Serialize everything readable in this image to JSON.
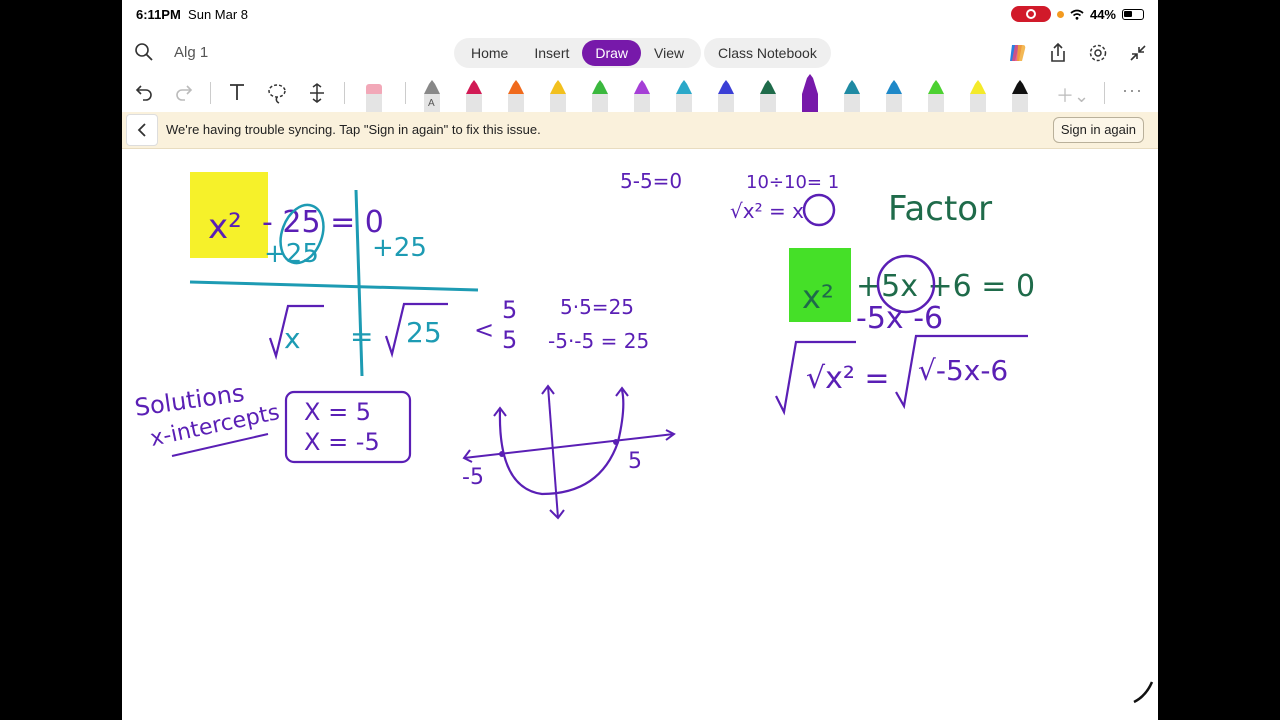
{
  "status": {
    "time": "6:11PM",
    "date": "Sun Mar 8",
    "battery": "44%"
  },
  "header": {
    "notebook_title": "Alg 1"
  },
  "tabs": [
    {
      "label": "Home",
      "active": false
    },
    {
      "label": "Insert",
      "active": false
    },
    {
      "label": "Draw",
      "active": true
    },
    {
      "label": "View",
      "active": false
    }
  ],
  "class_notebook_label": "Class Notebook",
  "icons": {
    "top_right": [
      "copilot-icon",
      "share-icon",
      "settings-icon",
      "collapse-icon"
    ],
    "toolbar": [
      "undo-icon",
      "redo-icon",
      "text-icon",
      "lasso-icon",
      "insert-space-icon",
      "eraser-icon",
      "add-pen-icon",
      "more-icon"
    ]
  },
  "pens": [
    {
      "color": "#888888",
      "label": "A"
    },
    {
      "color": "#d11a54",
      "label": ""
    },
    {
      "color": "#f06a1c",
      "label": ""
    },
    {
      "color": "#f2c01e",
      "label": ""
    },
    {
      "color": "#3bb83e",
      "label": ""
    },
    {
      "color": "#a53fd6",
      "label": ""
    },
    {
      "color": "#2aa8c9",
      "label": ""
    },
    {
      "color": "#3b3fd6",
      "label": ""
    },
    {
      "color": "#1f6b4a",
      "label": ""
    },
    {
      "color": "#7719aa",
      "label": ""
    },
    {
      "color": "#1f8aa3",
      "label": ""
    },
    {
      "color": "#1e88c8",
      "label": ""
    },
    {
      "color": "#4cd131",
      "label": ""
    },
    {
      "color": "#f4ea2a",
      "label": ""
    },
    {
      "color": "#111111",
      "label": ""
    }
  ],
  "banner": {
    "message": "We're having trouble syncing. Tap \"Sign in again\" to fix this issue.",
    "button": "Sign in again"
  },
  "colors": {
    "accent": "#7719aa",
    "ink_purple": "#5a1fb5",
    "ink_teal": "#1d9bb3",
    "ink_green": "#1f6b4a",
    "highlight_yellow": "#f6f12a",
    "highlight_green": "#45e028"
  },
  "ink": {
    "eq1_left": "x²",
    "eq1_minus": "- 25 = 0",
    "eq1_plus_left": "+25",
    "eq1_plus_right": "+25",
    "sqrt_left": "√x",
    "sqrt_right": "= √25",
    "roots": "< 5 5",
    "check1": "5·5=25",
    "check2": "-5·-5 = 25",
    "solutions_label": "Solutions",
    "intercepts_label": "x-intercepts",
    "sol1": "X = 5",
    "sol2": "X = -5",
    "graph_neg": "-5",
    "graph_pos": "5",
    "note1": "5-5=0",
    "note2": "10÷10= 1",
    "note3": "√x² = x",
    "factor_label": "Factor",
    "eq2_x2": "x²",
    "eq2_rest": "+5x +6 = 0",
    "eq2_sub": "-5x -6",
    "eq2_sqrt_left": "√x² =",
    "eq2_sqrt_right": "√-5x-6"
  }
}
